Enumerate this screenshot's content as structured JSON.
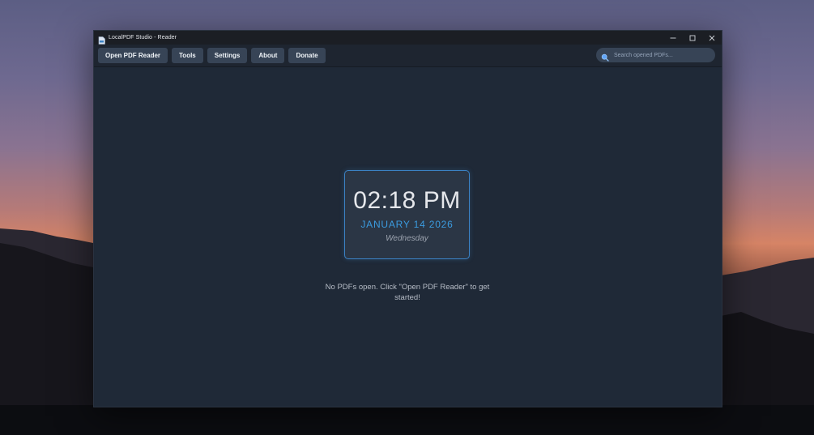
{
  "window": {
    "title": "LocalPDF Studio - Reader"
  },
  "toolbar": {
    "buttons": [
      {
        "label": "Open PDF Reader"
      },
      {
        "label": "Tools"
      },
      {
        "label": "Settings"
      },
      {
        "label": "About"
      },
      {
        "label": "Donate"
      }
    ],
    "search_placeholder": "Search opened PDFs..."
  },
  "clock": {
    "time": "02:18 PM",
    "date": "JANUARY 14 2026",
    "day": "Wednesday"
  },
  "empty_state": {
    "message": "No PDFs open. Click \"Open PDF Reader\" to get started!"
  },
  "colors": {
    "accent": "#3b9bdf",
    "window_bg": "#1f2937",
    "button_bg": "#374456",
    "titlebar_bg": "#1b1e24"
  },
  "icons": {
    "app": "pdf-document-icon",
    "search": "search-icon",
    "minimize": "minimize-icon",
    "maximize": "maximize-icon",
    "close": "close-icon"
  }
}
